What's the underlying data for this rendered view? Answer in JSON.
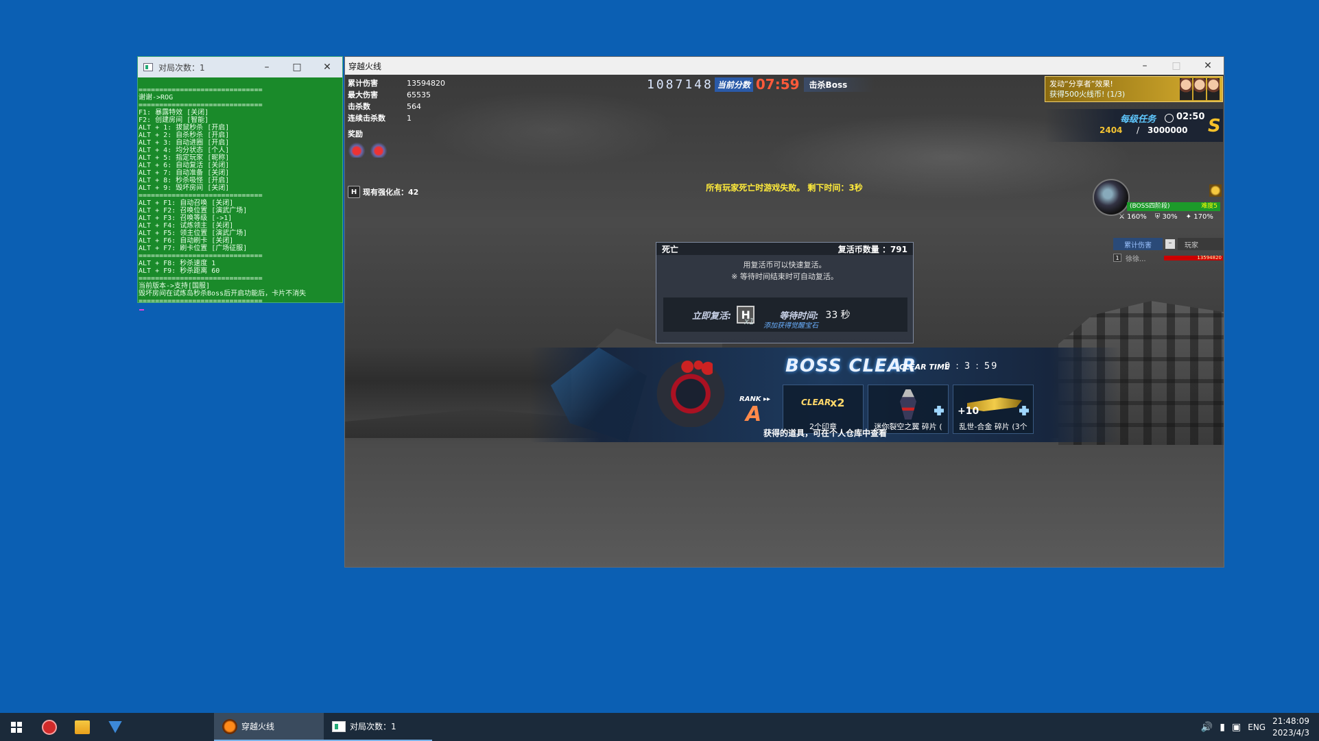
{
  "console": {
    "title": "对局次数：1",
    "lines": [
      "==============================",
      "谢谢->ROG",
      "==============================",
      "F1: 暴露特效 [关闭]",
      "F2: 创建房间 [智能]",
      "ALT + 1: 拔鼠秒杀 [开启]",
      "ALT + 2: 自杀秒杀 [开启]",
      "ALT + 3: 自动进圈 [开启]",
      "ALT + 4: 均分状态 [个人]",
      "ALT + 5: 指定玩家 [昵称]",
      "ALT + 6: 自动复活 [关闭]",
      "ALT + 7: 自动准备 [关闭]",
      "ALT + 8: 秒杀吸怪 [开启]",
      "ALT + 9: 毁坏房间 [关闭]",
      "==============================",
      "ALT + F1: 自动召唤 [关闭]",
      "ALT + F2: 召唤位置 [演武广场]",
      "ALT + F3: 召唤等级 [->1]",
      "ALT + F4: 试炼领主 [关闭]",
      "ALT + F5: 领主位置 [演武广场]",
      "ALT + F6: 自动刷卡 [关闭]",
      "ALT + F7: 刷卡位置 [广场征服]",
      "==============================",
      "ALT + F8: 秒杀速度 1",
      "ALT + F9: 秒杀距离 60",
      "==============================",
      "当前版本->支持[国服]",
      "毁坏房间在试炼岛秒杀Boss后开启功能后，卡片不消失",
      "=============================="
    ]
  },
  "game": {
    "title": "穿越火线",
    "stats": [
      {
        "label": "累计伤害",
        "value": "13594820"
      },
      {
        "label": "最大伤害",
        "value": "65535"
      },
      {
        "label": "击杀数",
        "value": "564"
      },
      {
        "label": "连续击杀数",
        "value": "1"
      }
    ],
    "reward_label": "奖励",
    "strength_key": "H",
    "strength_text": "现有强化点：42",
    "score": "1087148",
    "score_label": "当前分数",
    "timer": "07:59",
    "kill_boss": "击杀Boss",
    "banner_line1": "发动“分享者”效果!",
    "banner_line2": "获得500火线币! (1/3)",
    "quest_label": "每级任务",
    "quest_time": "02:50",
    "quest_value": "2404",
    "quest_sep": "/",
    "quest_max": "3000000",
    "quest_grade": "S",
    "boss_name": "(BOSS四阶段)",
    "boss_diff": "难度5",
    "boss_atk": "160%",
    "boss_def": "30%",
    "boss_spd": "170%",
    "dmg_tab1": "累计伤害",
    "dmg_tab2": "玩家",
    "dmg_rank": "1",
    "dmg_player": "徐徐...",
    "dmg_value": "13594820",
    "warning": "所有玩家死亡时游戏失败。 剩下时间：3秒",
    "death": {
      "title": "死亡",
      "coins_label": "复活币数量 ：791",
      "msg1": "用复活币可以快速复活。",
      "msg2": "※ 等待时间结束时可自动复活。",
      "revive_label": "立即复活:",
      "revive_key": "H",
      "revive_x": "x1",
      "revive_note": "添加获得觉醒宝石",
      "wait_label": "等待时间:",
      "wait_value": "33 秒"
    },
    "boss_clear": {
      "title": "BOSS CLEAR",
      "clear_time_label": "CLEAR TIME",
      "clear_time_value": "0 : 3 : 59",
      "rank_label": "RANK ▸▸",
      "rank_value": "A",
      "item1_badge": "CLEAR",
      "item1_mult": "x2",
      "item1_caption": "2个印章",
      "item2_caption": "迷你裂空之翼 碎片 (",
      "item3_plus": "+10",
      "item3_caption": "乱世-合金 碎片 (3个",
      "footer": "获得的道具，可在个人仓库中查看"
    }
  },
  "taskbar": {
    "app1": "穿越火线",
    "app2": "对局次数：1",
    "lang": "ENG",
    "time": "21:48:09",
    "date": "2023/4/3"
  }
}
